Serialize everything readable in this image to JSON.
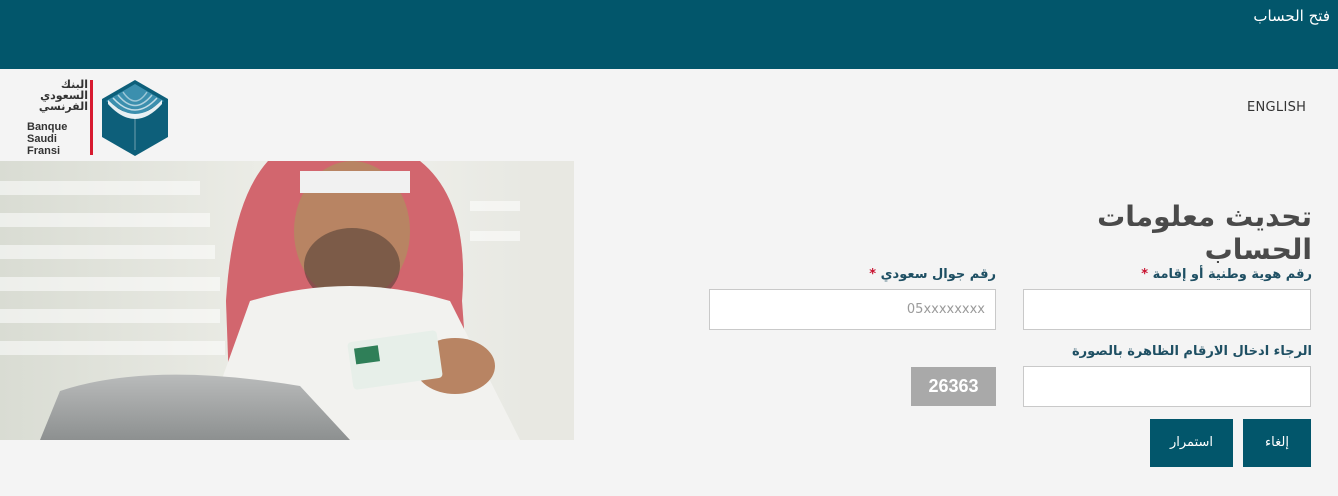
{
  "topbar": {
    "title": "فتح الحساب"
  },
  "header": {
    "language_link": "ENGLISH",
    "logo": {
      "arabic_line1": "البنك",
      "arabic_line2": "السعودي",
      "arabic_line3": "الفرنسي",
      "french_line1": "Banque",
      "french_line2": "Saudi",
      "french_line3": "Fransi",
      "brand_color": "#02566b",
      "accent_color": "#d71a2f"
    }
  },
  "hero": {
    "image": "man-holding-id-card-photo"
  },
  "form": {
    "title": "تحديث معلومات الحساب",
    "id_label": "رقم هوية وطنية أو إقامة",
    "mobile_label": "رقم جوال سعودي",
    "required_mark": "*",
    "mobile_placeholder": "05xxxxxxxx",
    "id_value": "",
    "mobile_value": "",
    "captcha_label": "الرجاء ادخال الارقام الظاهرة بالصورة",
    "captcha_code": "26363",
    "captcha_value": "",
    "cancel_button": "إلغاء",
    "continue_button": "استمرار"
  },
  "colors": {
    "topbar": "#02566b",
    "button": "#02566b",
    "background": "#f4f4f4",
    "required": "#c8102e"
  }
}
